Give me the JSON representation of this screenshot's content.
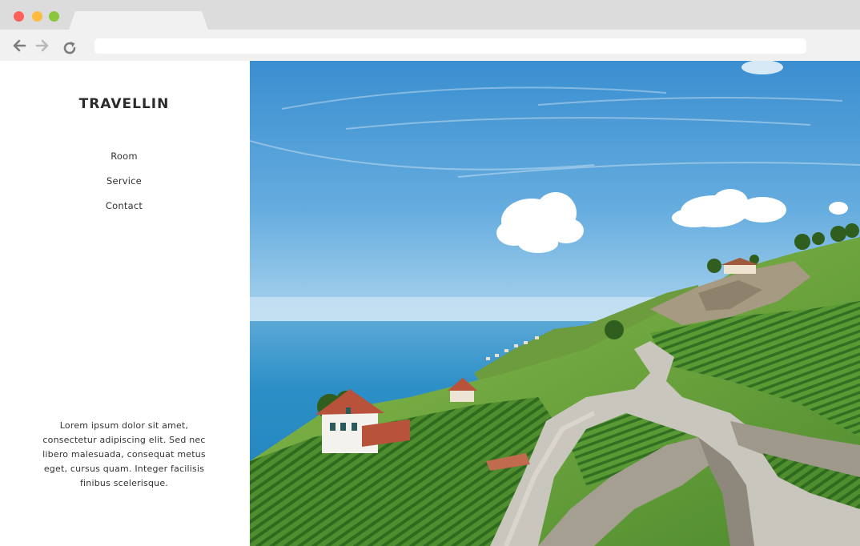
{
  "browser": {
    "window_controls": {
      "close_color": "#fc605c",
      "minimize_color": "#fdbc40",
      "maximize_color": "#34c84a"
    },
    "icons": {
      "back": "back-arrow-icon",
      "forward": "forward-arrow-icon",
      "reload": "reload-icon"
    },
    "address_value": ""
  },
  "sidebar": {
    "brand": "TRAVELLIN",
    "nav": [
      {
        "label": "Room"
      },
      {
        "label": "Service"
      },
      {
        "label": "Contact"
      }
    ],
    "blurb": "Lorem ipsum dolor sit amet, consectetur adipiscing elit. Sed nec libero malesuada, consequat metus eget, cursus quam. Integer facilisis finibus scelerisque."
  },
  "hero": {
    "image": "coastal-vineyard-landscape"
  },
  "colors": {
    "sky_top": "#3a8ed0",
    "sky_bottom": "#a8d3ee",
    "sea": "#2c8fc6",
    "vineyard": "#3f7a2a",
    "brand_text": "#2b2b2b"
  }
}
